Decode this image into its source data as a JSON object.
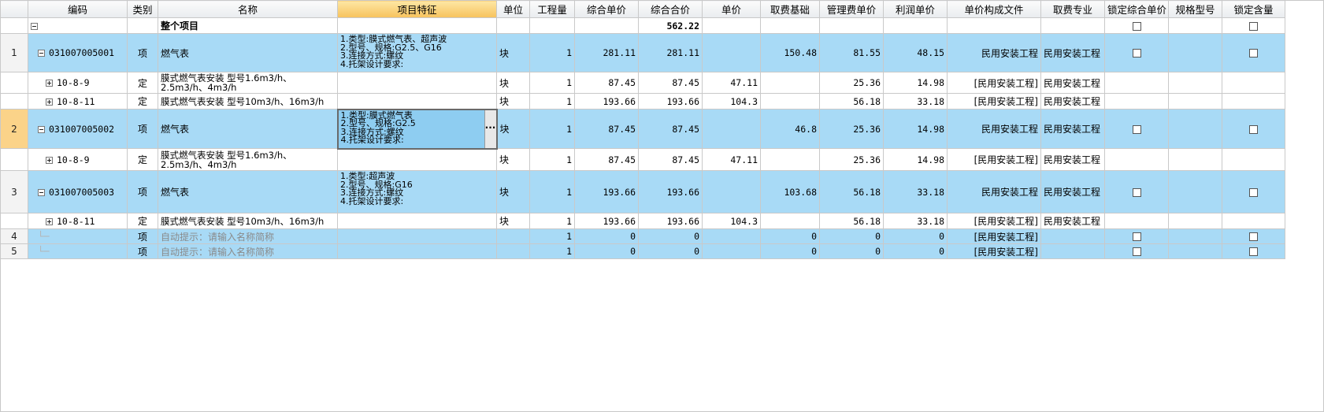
{
  "columns": [
    "编码",
    "类别",
    "名称",
    "项目特征",
    "单位",
    "工程量",
    "综合单价",
    "综合合价",
    "单价",
    "取费基础",
    "管理费单价",
    "利润单价",
    "单价构成文件",
    "取费专业",
    "锁定综合单价",
    "规格型号",
    "锁定含量"
  ],
  "active_column": "项目特征",
  "summary": {
    "name": "整个项目",
    "total": "562.22"
  },
  "rows": [
    {
      "rn": "1",
      "code": "031007005001",
      "type": "项",
      "name": "燃气表",
      "feature": "1.类型:膜式燃气表、超声波\n2.型号、规格:G2.5、G16\n3.连接方式:螺纹\n4.托架设计要求:",
      "unit": "块",
      "qty": "1",
      "cup": "281.11",
      "ctotal": "281.11",
      "price": "",
      "base": "150.48",
      "mgmt": "81.55",
      "profit": "48.15",
      "file": "民用安装工程",
      "spec": "民用安装工程"
    },
    {
      "code": "10-8-9",
      "type": "定",
      "name": "膜式燃气表安装 型号1.6m3/h、2.5m3/h、4m3/h",
      "unit": "块",
      "qty": "1",
      "cup": "87.45",
      "ctotal": "87.45",
      "price": "47.11",
      "base": "",
      "mgmt": "25.36",
      "profit": "14.98",
      "file": "[民用安装工程]",
      "spec": "民用安装工程"
    },
    {
      "code": "10-8-11",
      "type": "定",
      "name": "膜式燃气表安装 型号10m3/h、16m3/h",
      "unit": "块",
      "qty": "1",
      "cup": "193.66",
      "ctotal": "193.66",
      "price": "104.3",
      "base": "",
      "mgmt": "56.18",
      "profit": "33.18",
      "file": "[民用安装工程]",
      "spec": "民用安装工程"
    },
    {
      "rn": "2",
      "code": "031007005002",
      "type": "项",
      "name": "燃气表",
      "feature": "1.类型:膜式燃气表\n2.型号、规格:G2.5\n3.连接方式:螺纹\n4.托架设计要求:",
      "unit": "块",
      "qty": "1",
      "cup": "87.45",
      "ctotal": "87.45",
      "price": "",
      "base": "46.8",
      "mgmt": "25.36",
      "profit": "14.98",
      "file": "民用安装工程",
      "spec": "民用安装工程"
    },
    {
      "code": "10-8-9",
      "type": "定",
      "name": "膜式燃气表安装 型号1.6m3/h、2.5m3/h、4m3/h",
      "unit": "块",
      "qty": "1",
      "cup": "87.45",
      "ctotal": "87.45",
      "price": "47.11",
      "base": "",
      "mgmt": "25.36",
      "profit": "14.98",
      "file": "[民用安装工程]",
      "spec": "民用安装工程"
    },
    {
      "rn": "3",
      "code": "031007005003",
      "type": "项",
      "name": "燃气表",
      "feature": "1.类型:超声波\n2.型号、规格:G16\n3.连接方式:螺纹\n4.托架设计要求:",
      "unit": "块",
      "qty": "1",
      "cup": "193.66",
      "ctotal": "193.66",
      "price": "",
      "base": "103.68",
      "mgmt": "56.18",
      "profit": "33.18",
      "file": "民用安装工程",
      "spec": "民用安装工程"
    },
    {
      "code": "10-8-11",
      "type": "定",
      "name": "膜式燃气表安装 型号10m3/h、16m3/h",
      "unit": "块",
      "qty": "1",
      "cup": "193.66",
      "ctotal": "193.66",
      "price": "104.3",
      "base": "",
      "mgmt": "56.18",
      "profit": "33.18",
      "file": "[民用安装工程]",
      "spec": "民用安装工程"
    },
    {
      "rn": "4",
      "type": "项",
      "name": "自动提示：请输入名称简称",
      "qty": "1",
      "cup": "0",
      "ctotal": "0",
      "base": "0",
      "mgmt": "0",
      "profit": "0",
      "file": "[民用安装工程]"
    },
    {
      "rn": "5",
      "type": "项",
      "name": "自动提示：请输入名称简称",
      "qty": "1",
      "cup": "0",
      "ctotal": "0",
      "base": "0",
      "mgmt": "0",
      "profit": "0",
      "file": "[民用安装工程]"
    }
  ],
  "ellipsis_label": "···"
}
